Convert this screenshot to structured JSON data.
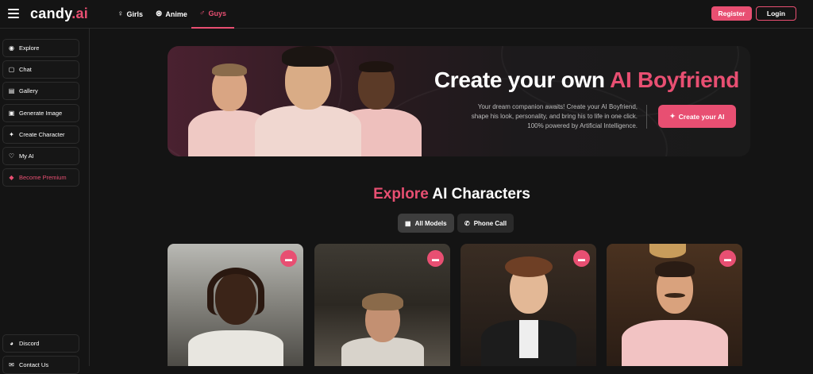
{
  "brand": {
    "name_main": "candy",
    "name_dot": ".ai",
    "accent": "#e84f72"
  },
  "nav": {
    "tabs": [
      {
        "label": "Girls",
        "icon": "female-icon"
      },
      {
        "label": "Anime",
        "icon": "anime-icon"
      },
      {
        "label": "Guys",
        "icon": "male-icon",
        "active": true
      }
    ],
    "register_label": "Register",
    "login_label": "Login"
  },
  "sidebar": {
    "items": [
      {
        "label": "Explore",
        "icon": "compass-icon"
      },
      {
        "label": "Chat",
        "icon": "chat-icon"
      },
      {
        "label": "Gallery",
        "icon": "gallery-icon"
      },
      {
        "label": "Generate Image",
        "icon": "image-icon"
      },
      {
        "label": "Create Character",
        "icon": "magic-wand-icon"
      },
      {
        "label": "My AI",
        "icon": "heart-icon"
      },
      {
        "label": "Become Premium",
        "icon": "diamond-icon"
      }
    ],
    "bottom_items": [
      {
        "label": "Discord",
        "icon": "discord-icon"
      },
      {
        "label": "Contact Us",
        "icon": "mail-icon"
      }
    ]
  },
  "hero": {
    "title_plain": "Create your own ",
    "title_accent": "AI Boyfriend",
    "subtitle_line1": "Your dream companion awaits! Create your AI Boyfriend,",
    "subtitle_line2": "shape his look, personality, and bring his to life in one click.",
    "subtitle_line3": "100% powered by Artificial Intelligence.",
    "cta_label": "Create your AI"
  },
  "explore": {
    "title_accent": "Explore",
    "title_plain": " AI Characters",
    "filters": [
      {
        "label": "All Models",
        "icon": "grid-icon",
        "active": true
      },
      {
        "label": "Phone Call",
        "icon": "phone-icon"
      }
    ]
  }
}
